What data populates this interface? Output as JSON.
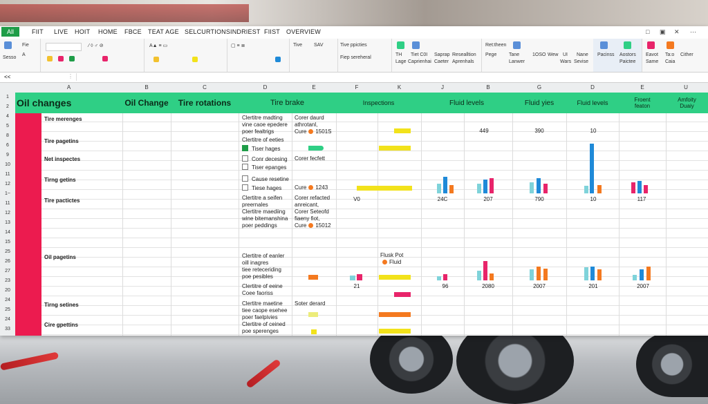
{
  "menu": {
    "file_label": "All",
    "tabs": [
      "FIIT",
      "LIVE",
      "HOIT",
      "HOME",
      "FBCE",
      "TEAT AGE",
      "SELCURTIONS",
      "INDRIEST",
      "FIIST",
      "OVERVIEW"
    ]
  },
  "ribbon": {
    "labels": [
      "Sesso",
      "Fie",
      "Tive",
      "SAV",
      "Tive ppicties",
      "Fiep sereheral",
      "TH",
      "Tiet C0I",
      "Saprap",
      "Resealltion",
      "Lage",
      "Caprienhai",
      "Caeter",
      "Aprenhals",
      "Ret:theen",
      "Pege",
      "Tane",
      "Lanwer",
      "1OSO",
      "Wew",
      "UI",
      "Wars",
      "Nane",
      "Sevise",
      "Pacinss",
      "Aostors",
      "Paictee",
      "Eavot",
      "Same",
      "Ta:o",
      "Caia",
      "Cither"
    ]
  },
  "formula_bar": {
    "name_box": "<<"
  },
  "columns": [
    "A",
    "B",
    "C",
    "D",
    "E",
    "F",
    "K",
    "J",
    "B",
    "G",
    "D",
    "E",
    "U"
  ],
  "row_numbers": [
    "1",
    "2",
    "4",
    "5",
    "8",
    "6",
    "9",
    "10",
    "11",
    "12",
    "1~",
    "11",
    "12",
    "13",
    "14",
    "15",
    "25",
    "26",
    "27",
    "23",
    "20",
    "24",
    "25",
    "24",
    "33"
  ],
  "header_row": {
    "a": "Oil changes",
    "b": "Oil Change",
    "c": "Tire rotations",
    "d": "Tire brake",
    "f": "Inspections",
    "j": "Fluid levels",
    "g": "Fluid yies",
    "d2": "Fluid levels",
    "e": "Froent\nfeaton",
    "u": "Amfoity\nDuaiy"
  },
  "rows_a": [
    "Tire merenges",
    "Tire pagetins",
    "Net inspectes",
    "Tirng getins",
    "Tire pactictes",
    "Oil pagetins",
    "Tirng setines",
    "Cire gpettins"
  ],
  "col_d": {
    "block1": [
      "Clertitre madting",
      "vine caoe epedere",
      "poer fealtrigs"
    ],
    "block2": "Clertitre of eeties",
    "block2_chk": "Tiser hages",
    "block3_chk": "Conr decesing",
    "block3_chk2": "Tiser epanges",
    "block4_chk": "Cause resetine",
    "block4_chk2": "Tiese hages",
    "block5": [
      "Clertitre a seifen",
      "preernales",
      "Clertitre maediing",
      "wine bitemanshina",
      "poer peddings"
    ],
    "block6": [
      "Clertitre of eanler",
      "oill inagres",
      "tiee reteceriding",
      "poe pesibles"
    ],
    "block7": [
      "Clertitre of eeine",
      "Coee faoriss"
    ],
    "block8": [
      "Clertitre maetine",
      "tiee caope esehee",
      "poer faelpivies"
    ],
    "block9": [
      "Clertitre of ceined",
      "poe sperenges"
    ]
  },
  "col_e": {
    "b1": [
      "Corer daurd",
      "athrotanl,"
    ],
    "b1_val": "Cure",
    "b1_num": "1501S",
    "b3": "Corer fecfett",
    "b4_val": "Cure",
    "b4_num": "1243",
    "b5": [
      "Corer refacted",
      "anreicant,",
      "Corer Seteofd",
      "fiaeny fiot,"
    ],
    "b5_val": "Cure",
    "b5_num": "15012",
    "b8": "Soter derard"
  },
  "col_k": {
    "legend1": "Flusk Pot",
    "legend2": "Fluid"
  },
  "values": {
    "row5": {
      "j": "449",
      "g": "390",
      "d": "10"
    },
    "row12b": {
      "f": "V0",
      "j": "24C",
      "b": "207",
      "g": "790",
      "d": "10",
      "e": "117"
    },
    "row23": {
      "f": "21",
      "j": "96",
      "b": "2080",
      "g": "2007",
      "d": "201",
      "e": "2007"
    }
  },
  "colors": {
    "header_green": "#2fcf85",
    "accent_red": "#ec1b4f",
    "bar_yellow": "#f2e21b",
    "bar_orange": "#f4791f",
    "bar_teal": "#7fd3da",
    "bar_blue": "#1f8ad8",
    "bar_pink": "#e8246a"
  }
}
